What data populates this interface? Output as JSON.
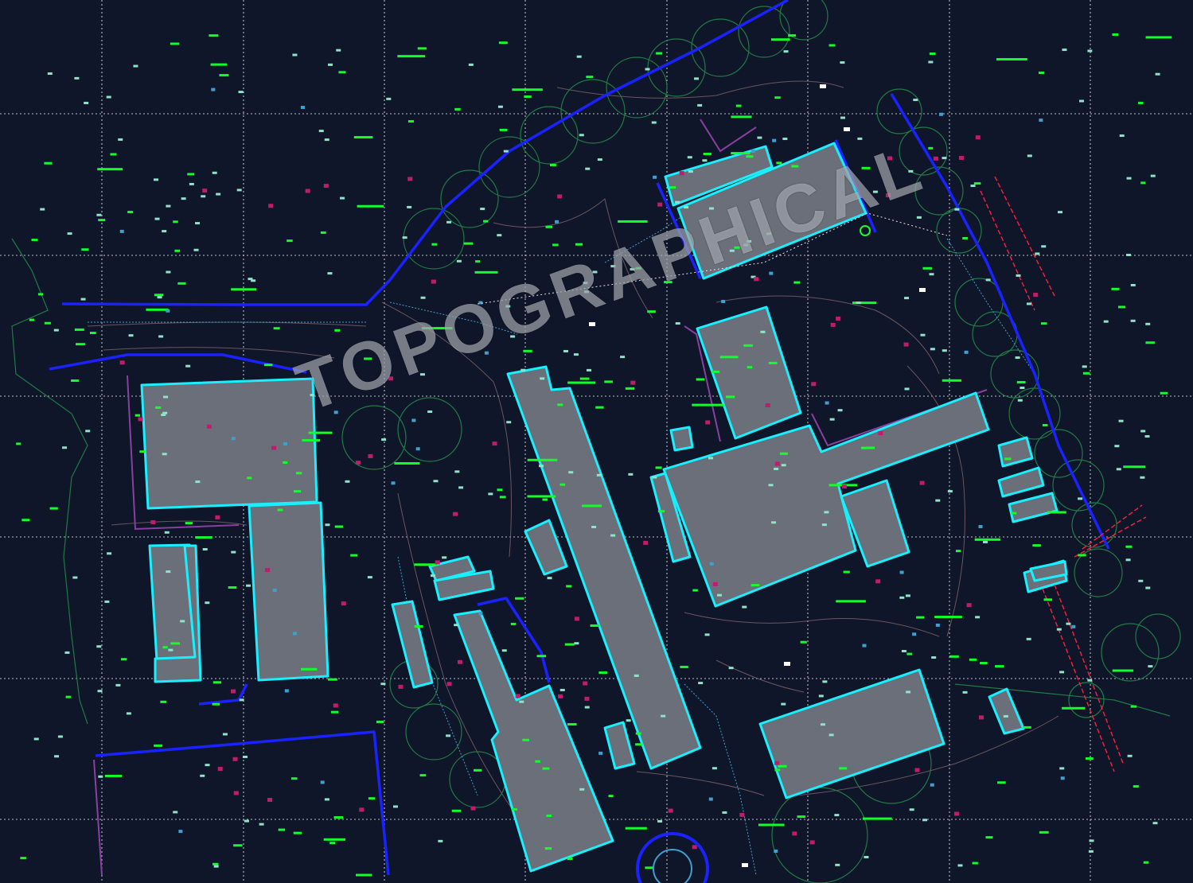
{
  "watermark": {
    "text": "TOPOGRAPHICAL"
  },
  "colors": {
    "background": "#0f1629",
    "grid": "#d6d9e0",
    "building_fill": "#6a6f7a",
    "building_outline": "#19f0ff",
    "boundary": "#1a22ff",
    "tree_canopy": "#1f7a45",
    "level_tag": "#12ff2a",
    "spot_height": "#8fe3c8",
    "contour": "#8a6a70",
    "survey_marker": "#c01c6e",
    "utility_line": "#3fa0d0",
    "fence": "#8a3fa0",
    "rail": "#ff1f3a"
  },
  "icons": [
    "tree-canopy-icon",
    "survey-station-icon",
    "level-tag-icon",
    "spot-height-icon"
  ]
}
